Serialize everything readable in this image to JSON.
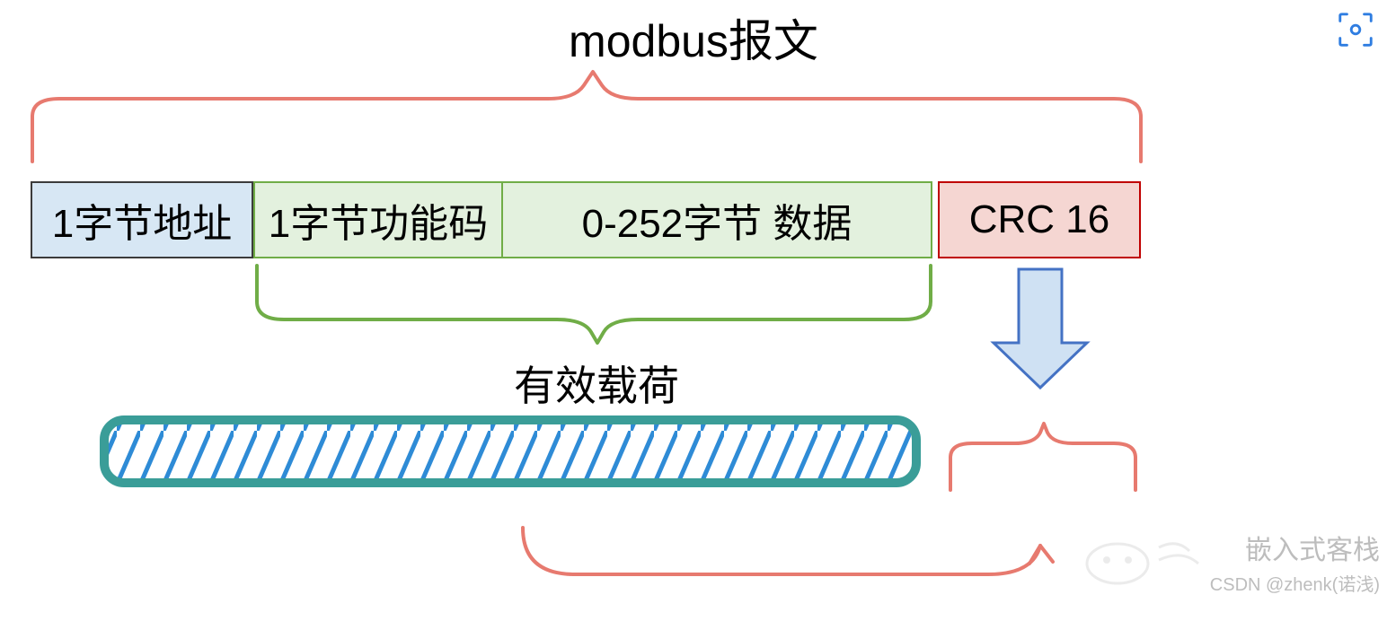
{
  "title": "modbus报文",
  "fields": {
    "address": "1字节地址",
    "function_code": "1字节功能码",
    "data": "0-252字节 数据",
    "crc": "CRC 16"
  },
  "payload_label": "有效载荷",
  "colors": {
    "address_bg": "#d7e7f4",
    "func_bg": "#e3f1de",
    "data_bg": "#e3f1de",
    "crc_bg": "#f5d6d2",
    "top_brace": "#e77a6f",
    "payload_brace": "#70ad47",
    "crc_brace": "#e77a6f",
    "arrow_fill": "#cfe1f3",
    "arrow_stroke": "#4472c4",
    "hatch": "#2e8bd6",
    "hatch_border": "#3a9d98"
  },
  "watermark": {
    "logo_name": "嵌入式客栈",
    "line2": "CSDN @zhenk(诺浅)"
  },
  "corner_icon": "focus-icon"
}
